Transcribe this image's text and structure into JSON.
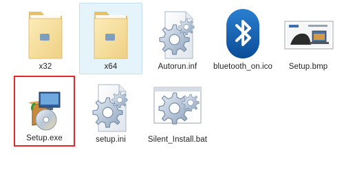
{
  "window": {
    "view_mode": "large-icons"
  },
  "files": [
    {
      "name": "x32",
      "type": "folder",
      "icon": "folder-icon"
    },
    {
      "name": "x64",
      "type": "folder",
      "icon": "folder-icon",
      "selected": true
    },
    {
      "name": "Autorun.inf",
      "type": "settings",
      "icon": "gear-document-icon"
    },
    {
      "name": "bluetooth_on.ico",
      "type": "icon",
      "icon": "bluetooth-icon"
    },
    {
      "name": "Setup.bmp",
      "type": "bitmap",
      "icon": "image-thumbnail-icon"
    },
    {
      "name": "Setup.exe",
      "type": "installer",
      "icon": "installer-icon",
      "highlighted": true
    },
    {
      "name": "setup.ini",
      "type": "settings",
      "icon": "gear-document-icon"
    },
    {
      "name": "Silent_Install.bat",
      "type": "batch",
      "icon": "gear-window-icon"
    }
  ],
  "colors": {
    "selection_bg": "#e5f3fb",
    "highlight_border": "#e2262a",
    "bluetooth_blue": "#1460ae",
    "folder_yellow": "#f3d98a"
  }
}
